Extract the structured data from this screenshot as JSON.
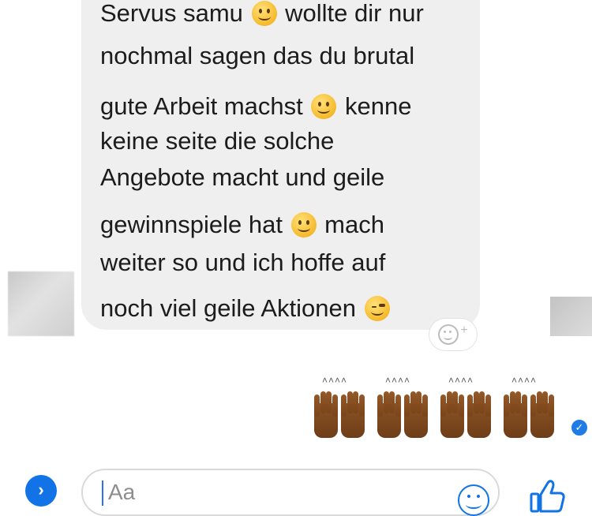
{
  "message": {
    "lines": [
      [
        "Servus samu ",
        "smile",
        " wollte dir nur"
      ],
      [
        "nochmal sagen das du brutal"
      ],
      [
        "gute Arbeit machst ",
        "smile",
        " kenne"
      ],
      [
        "keine seite die solche"
      ],
      [
        "Angebote macht und geile"
      ],
      [
        "gewinnspiele hat ",
        "smile",
        " mach"
      ],
      [
        "weiter so und ich hoffe auf"
      ],
      [
        "noch viel geile Aktionen ",
        "wink"
      ]
    ]
  },
  "reaction_button": {
    "icon": "add-reaction-icon",
    "plus": "+"
  },
  "sent_reply": {
    "emoji": "raising-hands",
    "count": 4,
    "skin_tone": "#7a4419"
  },
  "seen_indicator": {
    "icon": "check-icon",
    "glyph": "✓",
    "color": "#1f7be6"
  },
  "composer": {
    "placeholder": "Aa",
    "expand_icon": "chevron-right-icon",
    "emoji_icon": "smiley-icon",
    "like_icon": "thumbs-up-icon",
    "accent": "#1173e6"
  }
}
